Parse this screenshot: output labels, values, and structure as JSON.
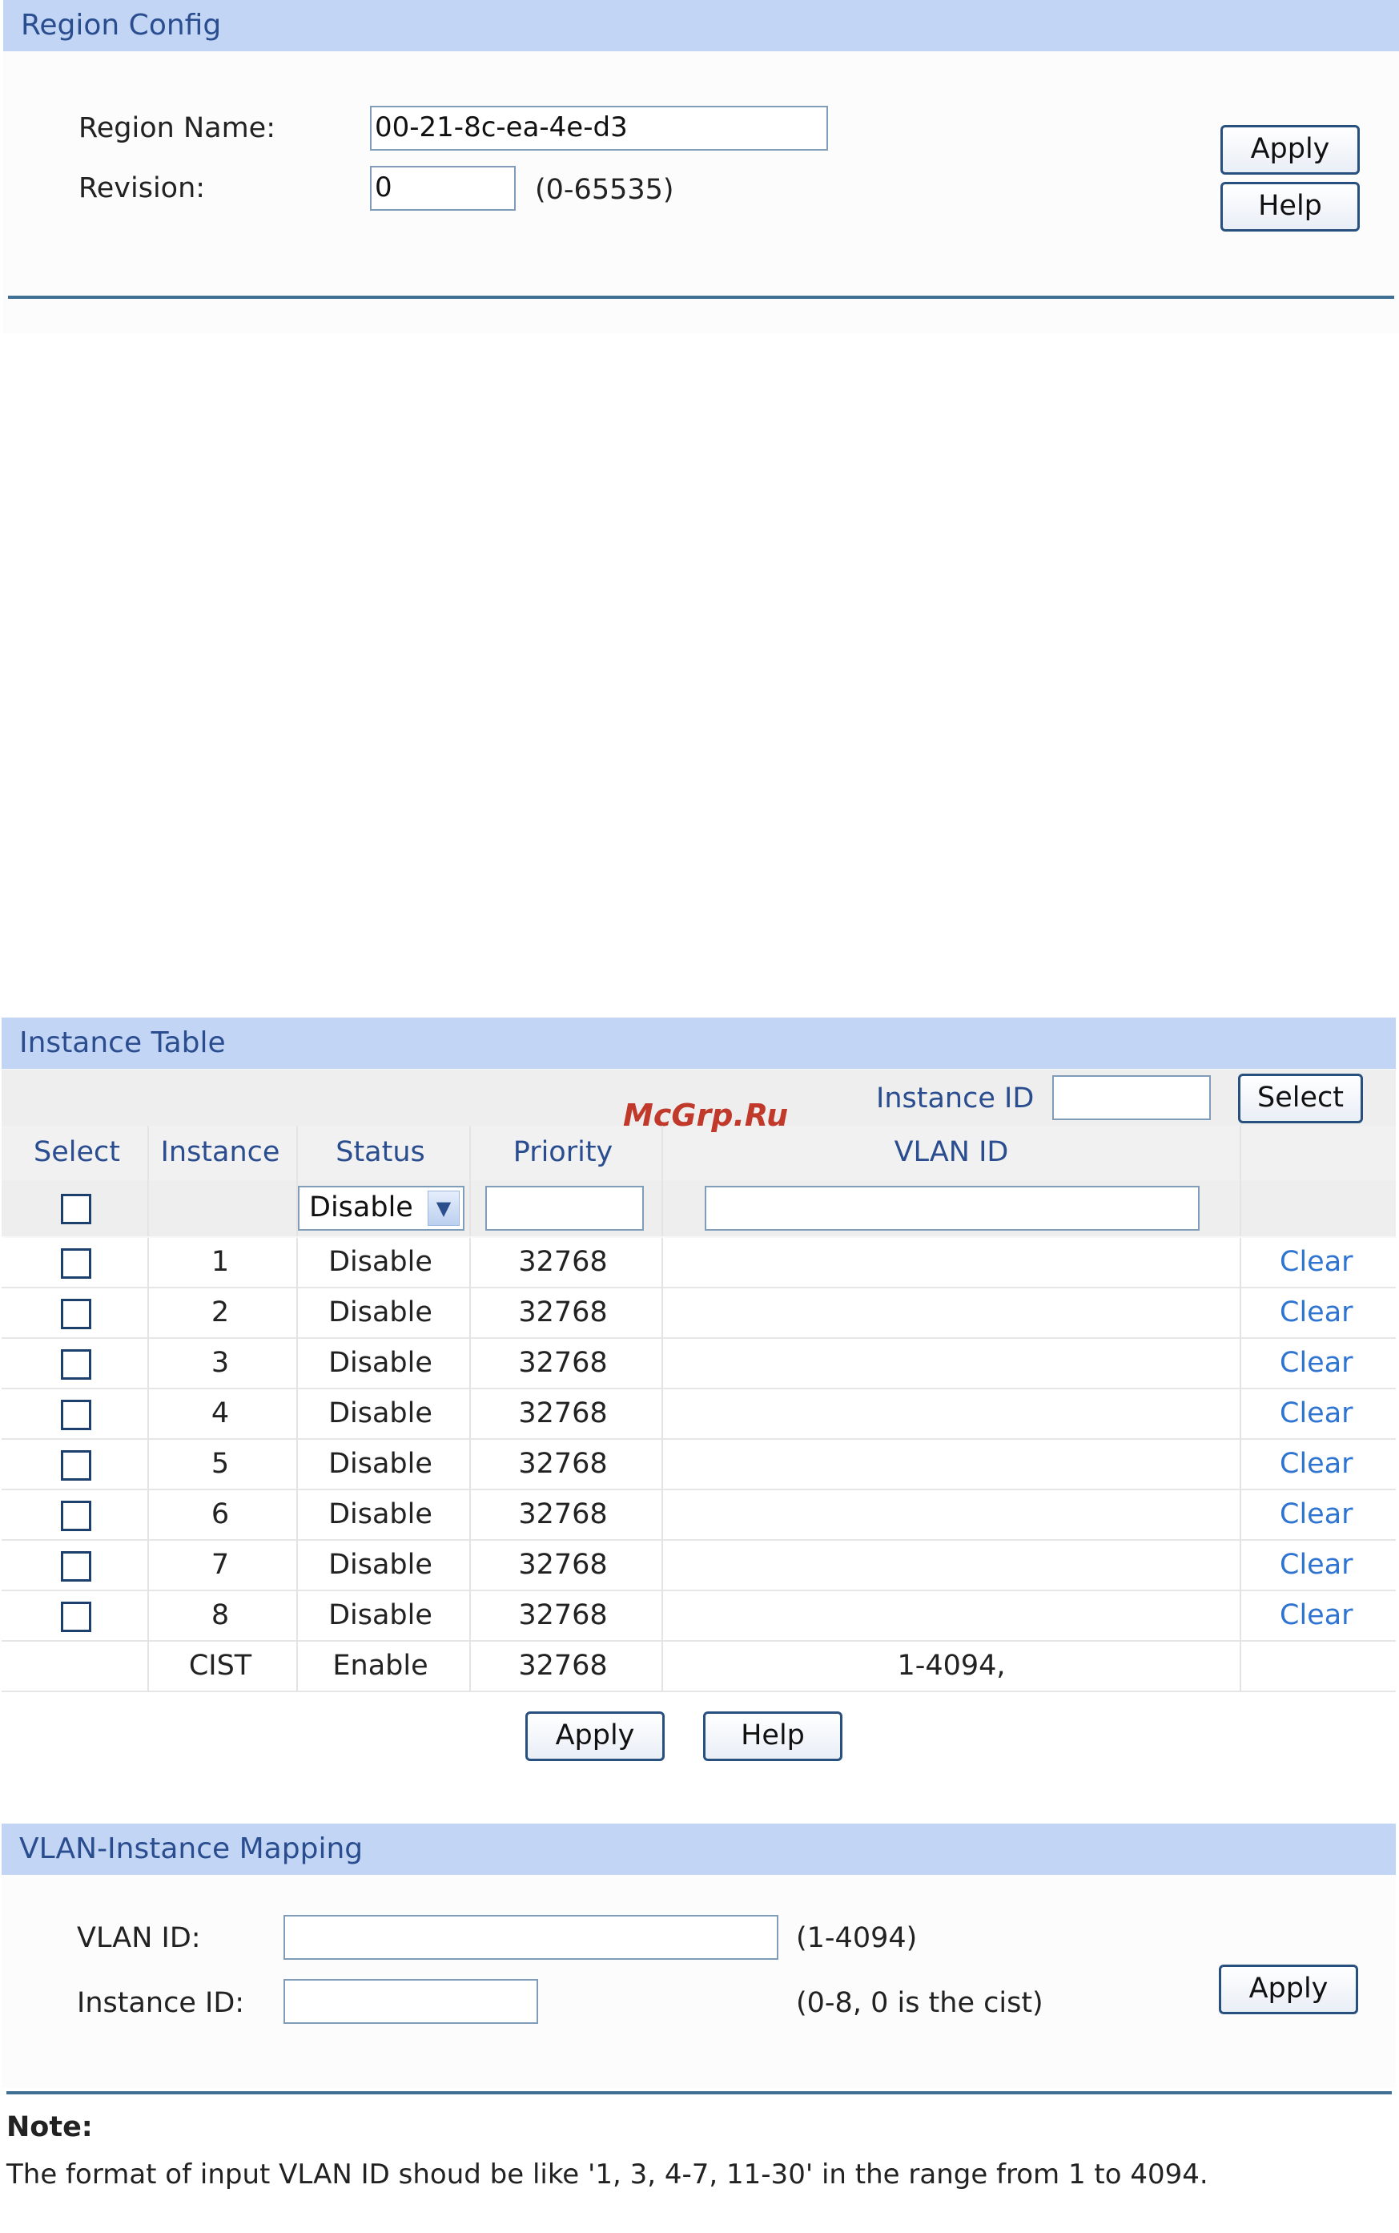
{
  "region_config": {
    "title": "Region Config",
    "region_name_label": "Region Name:",
    "region_name_value": "00-21-8c-ea-4e-d3",
    "revision_label": "Revision:",
    "revision_value": "0",
    "revision_range": "(0-65535)",
    "apply_label": "Apply",
    "help_label": "Help"
  },
  "instance_table": {
    "title": "Instance Table",
    "instance_id_label": "Instance ID",
    "instance_id_value": "",
    "select_button_label": "Select",
    "columns": [
      "Select",
      "Instance",
      "Status",
      "Priority",
      "VLAN ID"
    ],
    "filter_status_value": "Disable",
    "rows": [
      {
        "instance": "1",
        "status": "Disable",
        "priority": "32768",
        "vlan_id": "",
        "action": "Clear"
      },
      {
        "instance": "2",
        "status": "Disable",
        "priority": "32768",
        "vlan_id": "",
        "action": "Clear"
      },
      {
        "instance": "3",
        "status": "Disable",
        "priority": "32768",
        "vlan_id": "",
        "action": "Clear"
      },
      {
        "instance": "4",
        "status": "Disable",
        "priority": "32768",
        "vlan_id": "",
        "action": "Clear"
      },
      {
        "instance": "5",
        "status": "Disable",
        "priority": "32768",
        "vlan_id": "",
        "action": "Clear"
      },
      {
        "instance": "6",
        "status": "Disable",
        "priority": "32768",
        "vlan_id": "",
        "action": "Clear"
      },
      {
        "instance": "7",
        "status": "Disable",
        "priority": "32768",
        "vlan_id": "",
        "action": "Clear"
      },
      {
        "instance": "8",
        "status": "Disable",
        "priority": "32768",
        "vlan_id": "",
        "action": "Clear"
      }
    ],
    "cist_row": {
      "instance": "CIST",
      "status": "Enable",
      "priority": "32768",
      "vlan_id": "1-4094,"
    },
    "apply_label": "Apply",
    "help_label": "Help"
  },
  "watermark": "McGrp.Ru",
  "vlan_mapping": {
    "title": "VLAN-Instance Mapping",
    "vlan_id_label": "VLAN ID:",
    "vlan_id_value": "",
    "vlan_id_range": "(1-4094)",
    "instance_id_label": "Instance ID:",
    "instance_id_value": "",
    "instance_id_range": "(0-8, 0 is the cist)",
    "apply_label": "Apply"
  },
  "note": {
    "heading": "Note:",
    "text": "The format of input VLAN ID shoud be like '1, 3, 4-7, 11-30' in the range from 1 to 4094."
  }
}
